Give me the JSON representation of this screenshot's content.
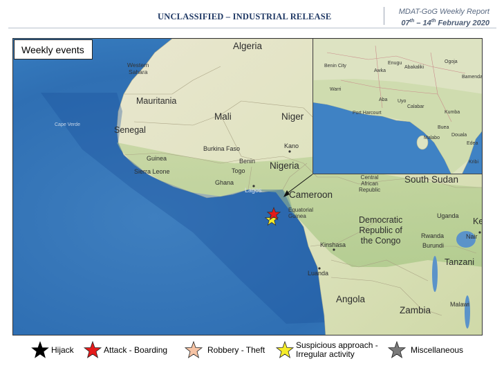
{
  "header": {
    "classification": "UNCLASSIFIED – INDUSTRIAL RELEASE",
    "report_title": "MDAT-GoG Weekly Report",
    "report_dates": "07th – 14th February 2020"
  },
  "map": {
    "box_label": "Weekly events",
    "countries": {
      "algeria": "Algeria",
      "western_sahara": "Western\nSahara",
      "mauritania": "Mauritania",
      "mali": "Mali",
      "niger": "Niger",
      "senegal": "Senegal",
      "cape_verde": "Cape Verde",
      "burkina_faso": "Burkina Faso",
      "guinea": "Guinea",
      "sierra_leone": "Sierra Leone",
      "benin": "Benin",
      "togo": "Togo",
      "ghana": "Ghana",
      "nigeria": "Nigeria",
      "cameroon": "Cameroon",
      "equatorial_guinea": "Equatorial\nGuinea",
      "car": "Central\nAfrican\nRepublic",
      "south_sudan": "South Sudan",
      "uganda": "Uganda",
      "drc": "Democratic\nRepublic of\nthe Congo",
      "rwanda": "Rwanda",
      "burundi": "Burundi",
      "tanzania": "Tanzani",
      "angola": "Angola",
      "zambia": "Zambia",
      "malawi": "Malawi",
      "kenya": "Ke",
      "nairobi": "Nair"
    },
    "cities": {
      "kano": "Kano",
      "lagos": "Lagos",
      "kinshasa": "Kinshasa",
      "luanda": "Luanda"
    },
    "inset_labels": {
      "benin_city": "Benin City",
      "enugu": "Enugu",
      "awka": "Awka",
      "abakaliki": "Abakaliki",
      "warri": "Warri",
      "ogoja": "Ogoja",
      "bamenda": "Bamenda",
      "aba": "Aba",
      "uyo": "Uyo",
      "calabar": "Calabar",
      "port_harcourt": "Port Harcourt",
      "kumba": "Kumba",
      "buea": "Buea",
      "malabo": "Malabo",
      "douala": "Douala",
      "edea": "Edea",
      "kribi": "Kribi"
    }
  },
  "legend": [
    {
      "label": "Hijack",
      "color": "#000000"
    },
    {
      "label": "Attack - Boarding",
      "color": "#e41a1a"
    },
    {
      "label": "Robbery - Theft",
      "color": "#f6c3a4"
    },
    {
      "label": "Suspicious approach -\nIrregular activity",
      "color": "#f5ec2a"
    },
    {
      "label": "Miscellaneous",
      "color": "#7a7a7a"
    }
  ],
  "incidents": [
    {
      "type": "Attack - Boarding",
      "color": "#e41a1a"
    },
    {
      "type": "Suspicious approach - Irregular activity",
      "color": "#f5ec2a"
    }
  ]
}
